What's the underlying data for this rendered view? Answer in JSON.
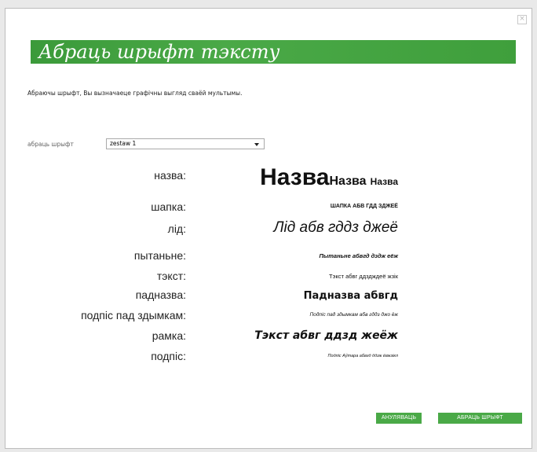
{
  "dialog": {
    "title": "Абраць шрыфт тэксту",
    "description": "Абраючы шрыфт, Вы вызначаеце графічны выгляд сваёй мультымы.",
    "font_label": "абраць шрыфт",
    "font_value": "zestaw 1",
    "cancel_label": "АНУЛЯВАЦЬ",
    "choose_label": "АБРАЦЬ ШРЫФТ"
  },
  "rows": [
    {
      "label": "назва:",
      "p1": "Назва",
      "p2": "Назва",
      "p3": "Назва"
    },
    {
      "label": "шапка:",
      "preview": "ШАПКА АБВ ГДД ЗДЖЕЁ"
    },
    {
      "label": "лід:",
      "preview": "Лід абв гддз джеё"
    },
    {
      "label": "пытаньне:",
      "preview": "Пытаньне абвгд дздж еёж"
    },
    {
      "label": "тэкст:",
      "preview": "Тэкст абвг ддздждеё жзік"
    },
    {
      "label": "падназва:",
      "preview": "Падназва абвгд"
    },
    {
      "label": "подпіс пад здымкам:",
      "preview": "Подпіс пад здымкам абв гддз джо ёж"
    },
    {
      "label": "рамка:",
      "preview": "Тэкст абвг ддзд жеёж"
    },
    {
      "label": "подпіс:",
      "preview": "Подпіс Аўтара абвгд ддзж ёвжзікл"
    }
  ],
  "colors": {
    "accent": "#4aa947"
  },
  "icons": {
    "close": "close-icon",
    "dropdown": "chevron-down-icon"
  }
}
